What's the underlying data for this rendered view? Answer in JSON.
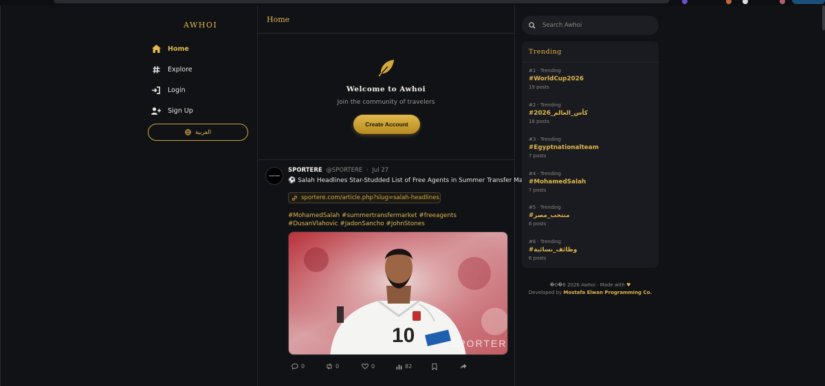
{
  "app": {
    "logo": "AWHOI"
  },
  "sidebar": {
    "items": [
      {
        "label": "Home",
        "icon": "home-icon",
        "active": true
      },
      {
        "label": "Explore",
        "icon": "hashtag-icon",
        "active": false
      },
      {
        "label": "Login",
        "icon": "login-icon",
        "active": false
      },
      {
        "label": "Sign Up",
        "icon": "user-plus-icon",
        "active": false
      }
    ],
    "language_button": "العربية"
  },
  "main": {
    "header_title": "Home",
    "welcome": {
      "title": "Welcome to Awhoi",
      "subtitle": "Join the community of travelers",
      "create_button": "Create Account"
    },
    "post": {
      "avatar_text": "SPORTERE",
      "author": "SPORTERE",
      "handle": "@SPORTERE",
      "separator": "·",
      "date": "Jul 27",
      "text": "⚽ Salah Headlines Star-Studded List of Free Agents in Summer Transfer Market",
      "link": "sportere.com/article.php?slug=salah-headlines...",
      "hashtags": "#MohamedSalah #summertransfermarket #freeagents #DusanVlahovic #JadonSancho #JohnStones",
      "image_watermark": "SPORTERE",
      "jersey_number": "10",
      "actions": {
        "replies": "0",
        "reposts": "0",
        "likes": "0",
        "views": "82"
      }
    }
  },
  "right": {
    "search_placeholder": "Search Awhoi",
    "trending_title": "Trending",
    "trends": [
      {
        "meta": "#1 · Trending",
        "tag": "#WorldCup2026",
        "count": "19 posts"
      },
      {
        "meta": "#2 · Trending",
        "tag": "#كأس_العالم_2026",
        "count": "18 posts"
      },
      {
        "meta": "#3 · Trending",
        "tag": "#Egyptnationalteam",
        "count": "7 posts"
      },
      {
        "meta": "#4 · Trending",
        "tag": "#MohamedSalah",
        "count": "7 posts"
      },
      {
        "meta": "#5 · Trending",
        "tag": "#منتخب_مصر",
        "count": "6 posts"
      },
      {
        "meta": "#6 · Trending",
        "tag": "#وظائف_نسائية",
        "count": "6 posts"
      }
    ],
    "footer": {
      "line1": "�0�8 2026 Awhoi · Made with",
      "line2_prefix": "Developed by",
      "developer": "Mostafa Elwan Programming Co."
    }
  },
  "colors": {
    "accent": "#e0b84b",
    "background": "#111216",
    "panel": "#1a1b20"
  }
}
